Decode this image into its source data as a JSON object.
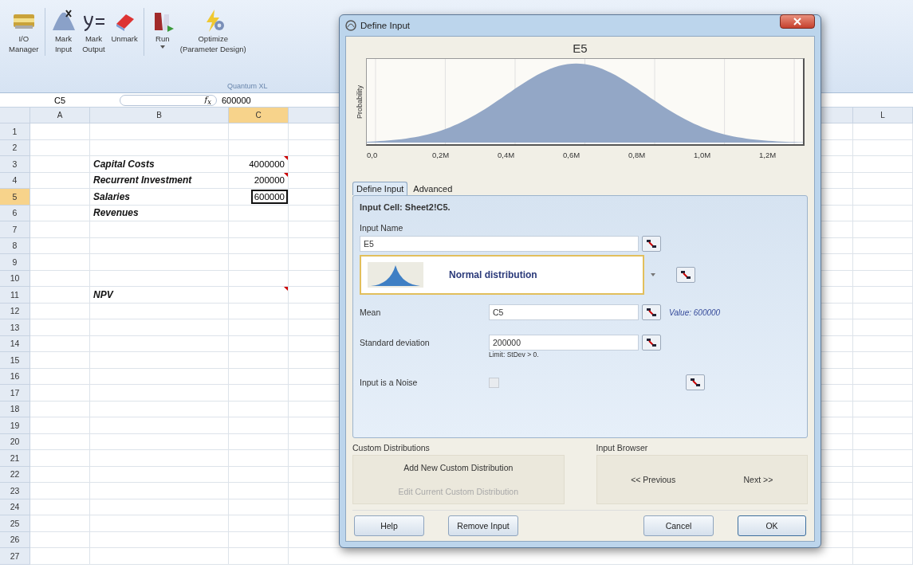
{
  "ribbon": {
    "buttons": [
      {
        "kind": "folder",
        "lines": [
          "I/O",
          "Manager"
        ]
      },
      {
        "kind": "mark-input",
        "lines": [
          "Mark",
          "Input"
        ]
      },
      {
        "kind": "mark-output",
        "lines": [
          "Mark",
          "Output"
        ]
      },
      {
        "kind": "unmark",
        "lines": [
          "Unmark"
        ]
      },
      {
        "kind": "run",
        "lines": [
          "Run"
        ],
        "dropdown": true
      },
      {
        "kind": "optimize",
        "lines": [
          "Optimize",
          "(Parameter Design)"
        ]
      }
    ],
    "group_label": "Quantum XL"
  },
  "formula_bar": {
    "name_box": "C5",
    "fx_symbol": "f$_{x}$",
    "value": "600000"
  },
  "sheet": {
    "columns": [
      {
        "label": "A",
        "selected": false
      },
      {
        "label": "B",
        "selected": false
      },
      {
        "label": "C",
        "selected": true
      }
    ],
    "far_column": "L",
    "rows": [
      {
        "number": "1",
        "selected": false
      },
      {
        "number": "2",
        "selected": false
      },
      {
        "number": "3",
        "selected": false,
        "label": "Capital Costs",
        "value": "4000000",
        "comment": true
      },
      {
        "number": "4",
        "selected": false,
        "label": "Recurrent Investment",
        "value": "200000",
        "comment": true
      },
      {
        "number": "5",
        "selected": true,
        "label": "Salaries",
        "value": "600000",
        "active": true
      },
      {
        "number": "6",
        "selected": false,
        "label": "Revenues"
      },
      {
        "number": "7",
        "selected": false
      },
      {
        "number": "8",
        "selected": false
      },
      {
        "number": "9",
        "selected": false
      },
      {
        "number": "10",
        "selected": false
      },
      {
        "number": "11",
        "selected": false,
        "label": "NPV",
        "comment": true
      },
      {
        "number": "12",
        "selected": false
      },
      {
        "number": "13",
        "selected": false
      },
      {
        "number": "14",
        "selected": false
      },
      {
        "number": "15",
        "selected": false
      },
      {
        "number": "16",
        "selected": false
      },
      {
        "number": "17",
        "selected": false
      },
      {
        "number": "18",
        "selected": false
      },
      {
        "number": "19",
        "selected": false
      },
      {
        "number": "20",
        "selected": false
      },
      {
        "number": "21",
        "selected": false
      },
      {
        "number": "22",
        "selected": false
      },
      {
        "number": "23",
        "selected": false
      },
      {
        "number": "24",
        "selected": false
      },
      {
        "number": "25",
        "selected": false
      },
      {
        "number": "26",
        "selected": false
      },
      {
        "number": "27",
        "selected": false
      }
    ]
  },
  "dialog": {
    "title": "Define Input",
    "chart": {
      "title": "E5",
      "ylabel": "Probability",
      "xtick_labels": [
        "0,0",
        "0,2M",
        "0,4M",
        "0,6M",
        "0,8M",
        "1,0M",
        "1,2M"
      ]
    },
    "tabs": [
      {
        "label": "Define Input",
        "selected": true
      },
      {
        "label": "Advanced",
        "selected": false
      }
    ],
    "input_cell": "Input Cell: Sheet2!C5.",
    "input_name": {
      "label": "Input Name",
      "value": "E5"
    },
    "distribution": "Normal distribution",
    "mean": {
      "label": "Mean",
      "value": "C5",
      "note": "Value: 600000"
    },
    "std_dev": {
      "label": "Standard deviation",
      "value": "200000",
      "hint": "Limit: StDev > 0."
    },
    "noise": {
      "label": "Input is a Noise",
      "checked": false,
      "disabled": true
    },
    "custom_distributions": {
      "title": "Custom Distributions",
      "links": [
        {
          "label": "Add New Custom Distribution",
          "disabled": false
        },
        {
          "label": "Edit Current Custom Distribution",
          "disabled": true
        }
      ]
    },
    "input_browser": {
      "title": "Input Browser",
      "previous": "<< Previous",
      "next": "Next >>"
    },
    "buttons": [
      {
        "label": "Help",
        "default": false
      },
      {
        "label": "Remove Input",
        "default": false
      },
      {
        "label": "Cancel",
        "default": false
      },
      {
        "label": "OK",
        "default": true
      }
    ]
  }
}
